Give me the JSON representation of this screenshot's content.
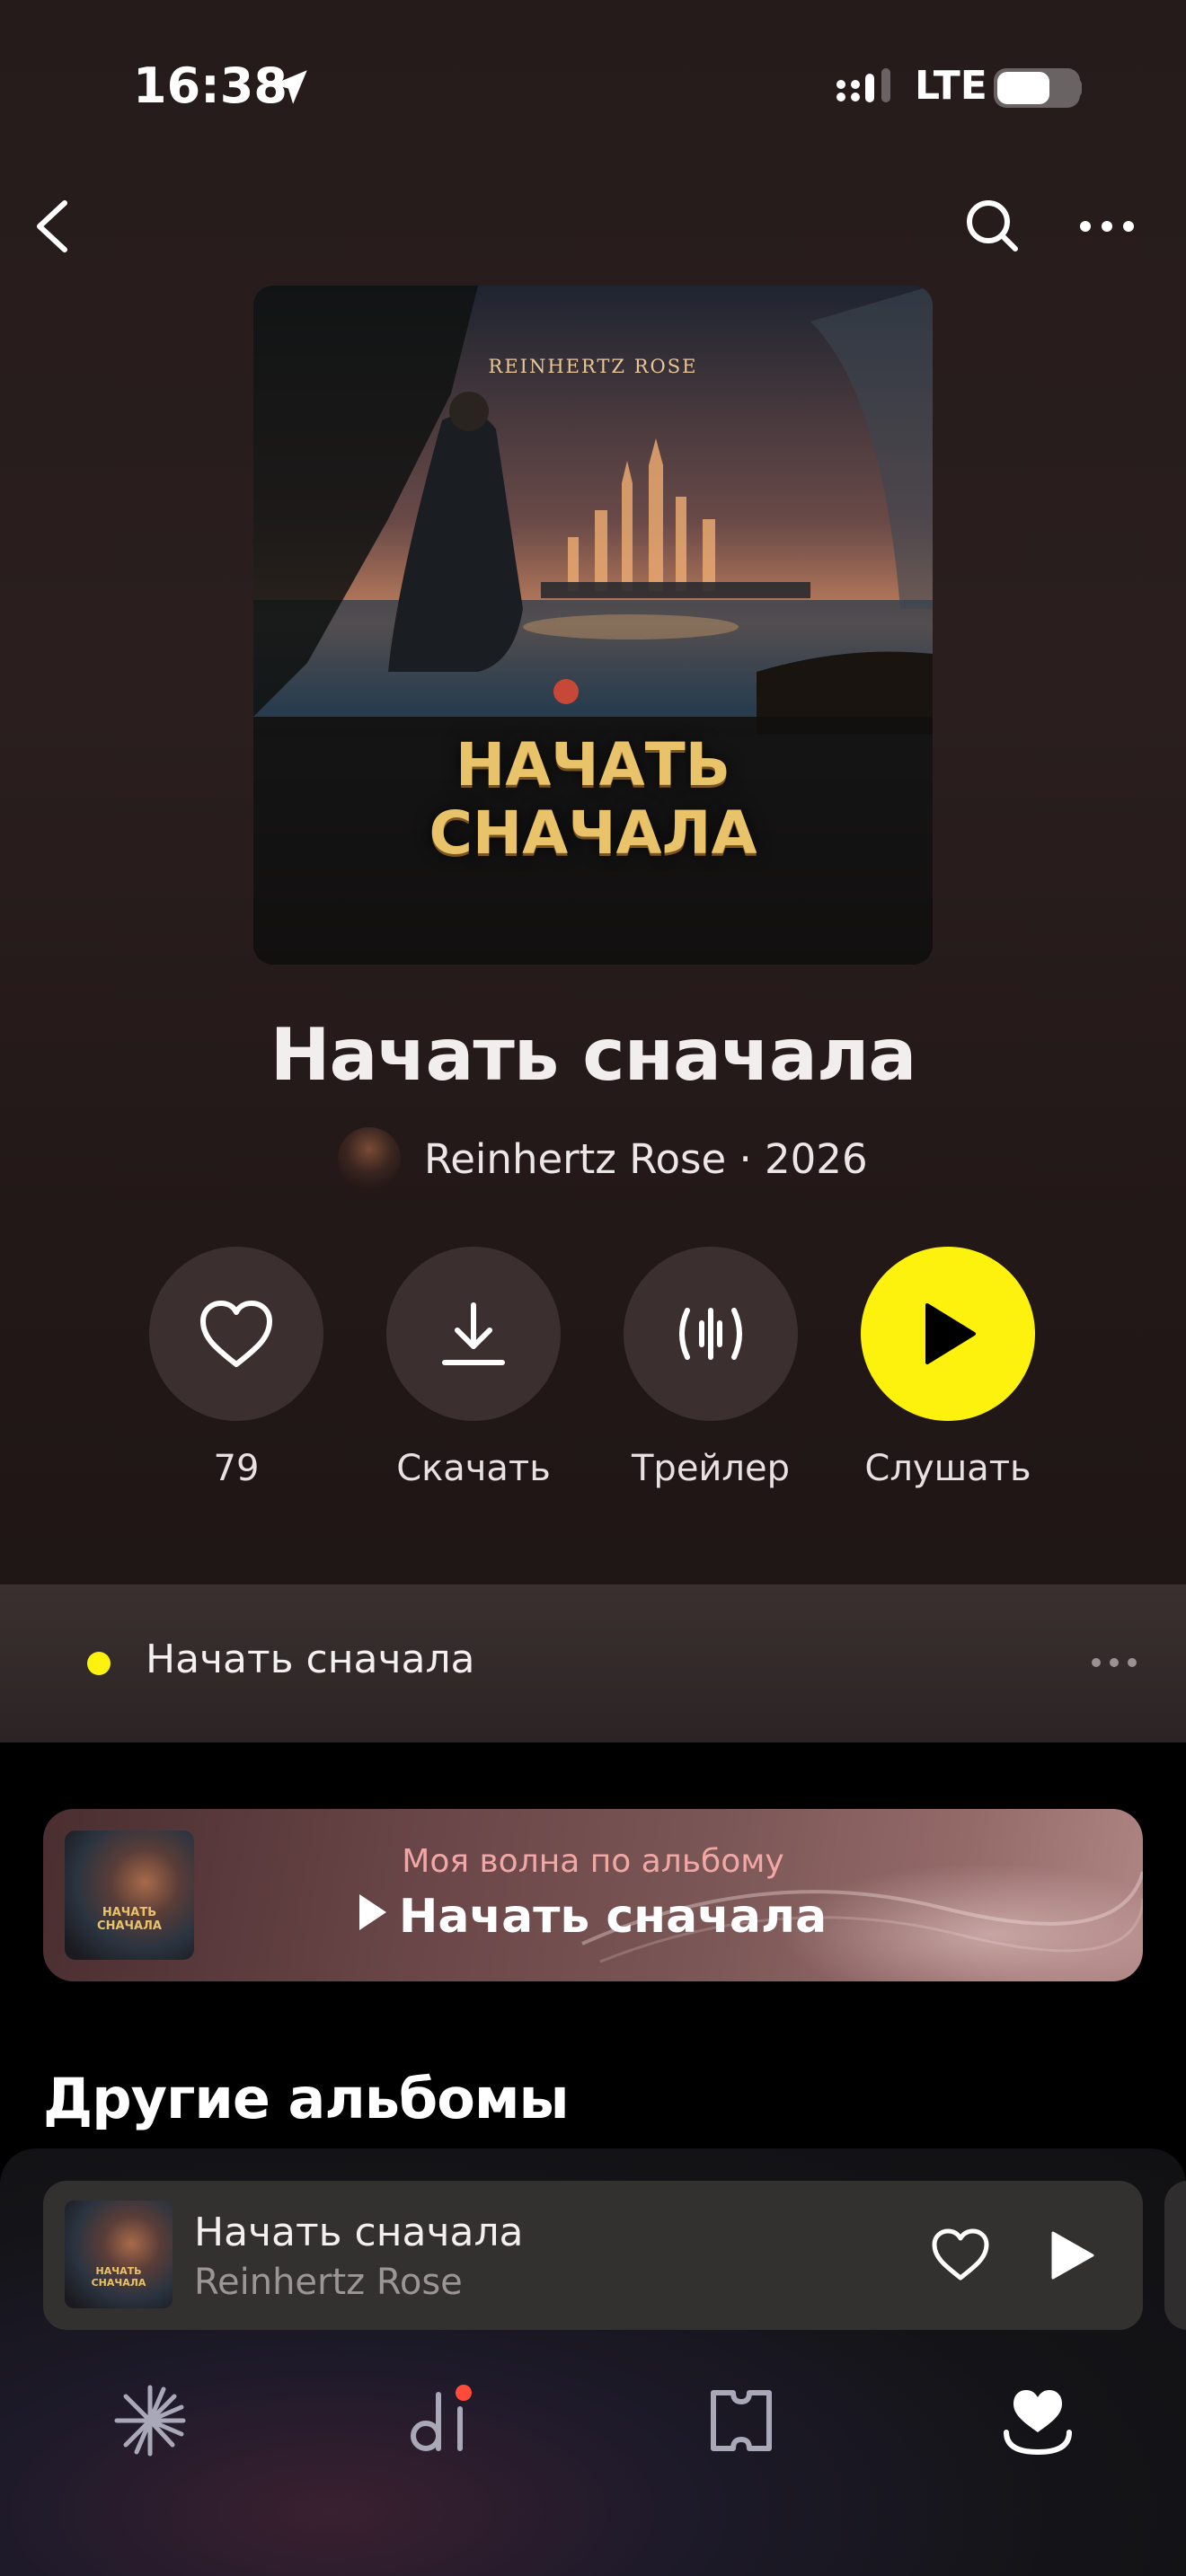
{
  "status_bar": {
    "time": "16:38",
    "network": "LTE",
    "battery_level": 0.65
  },
  "nav": {
    "back_icon": "chevron-left-icon",
    "search_icon": "search-icon",
    "more_icon": "more-horizontal-icon"
  },
  "album": {
    "cover_artist": "REINHERTZ ROSE",
    "cover_title_line1": "НАЧАТЬ",
    "cover_title_line2": "СНАЧАЛА",
    "title": "Начать сначала",
    "artist_year": "Reinhertz Rose · 2026"
  },
  "actions": {
    "likes_count": "79",
    "download_label": "Скачать",
    "trailer_label": "Трейлер",
    "listen_label": "Слушать"
  },
  "tracks": [
    {
      "title": "Начать сначала",
      "playing": true
    }
  ],
  "wave": {
    "subtitle": "Моя волна по альбому",
    "title": "Начать сначала"
  },
  "sections": {
    "other_albums": "Другие альбомы"
  },
  "mini_player": {
    "title": "Начать сначала",
    "artist": "Reinhertz Rose"
  },
  "tab_bar": [
    "wave-icon",
    "music-icon",
    "podcasts-icon",
    "collection-icon"
  ],
  "colors": {
    "accent": "#fdf20e",
    "background": "#261b1b",
    "button": "#3c2f2f",
    "wave_subtitle": "#f2a7a5"
  }
}
